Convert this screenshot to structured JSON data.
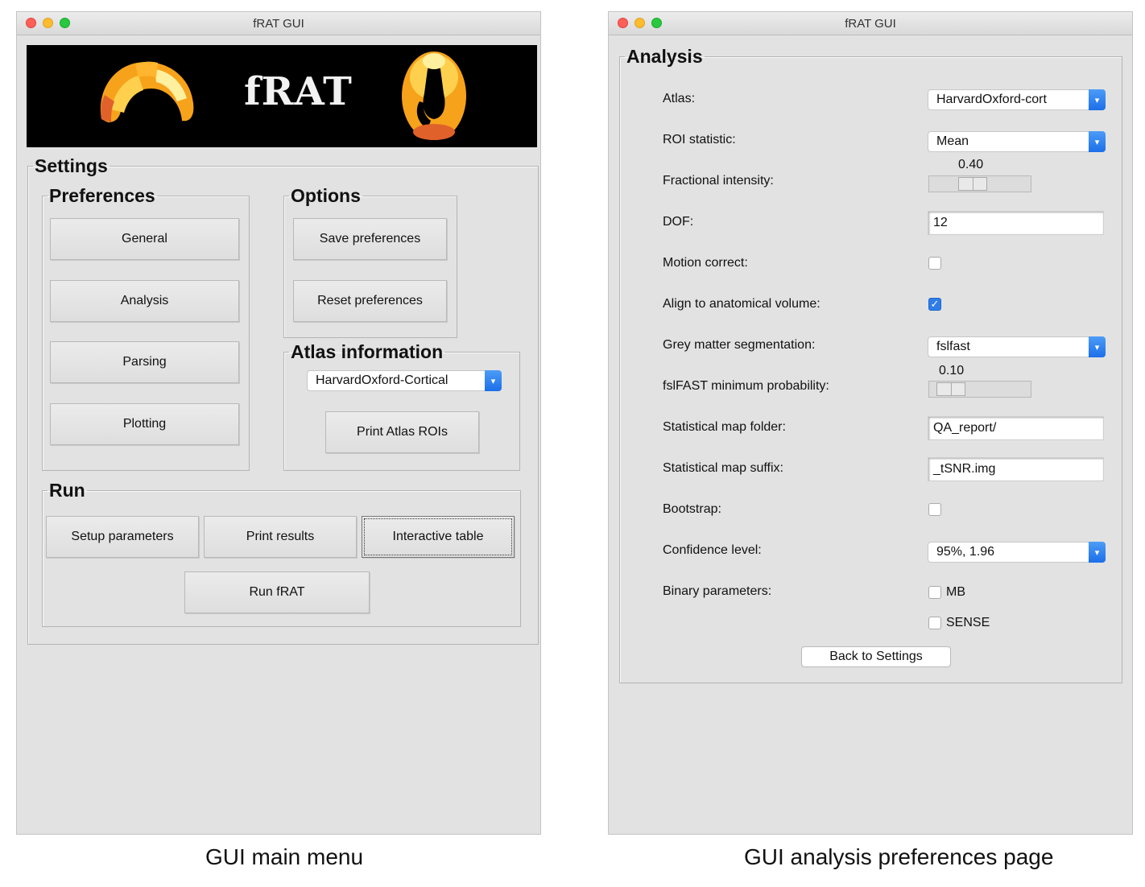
{
  "main_window": {
    "title": "fRAT GUI",
    "banner": {
      "logo_text": "fRAT"
    },
    "settings": {
      "legend": "Settings",
      "preferences": {
        "legend": "Preferences",
        "buttons": [
          "General",
          "Analysis",
          "Parsing",
          "Plotting"
        ]
      },
      "options": {
        "legend": "Options",
        "buttons": [
          "Save preferences",
          "Reset preferences"
        ]
      },
      "atlas_information": {
        "legend": "Atlas information",
        "atlas_select": "HarvardOxford-Cortical",
        "print_button": "Print Atlas ROIs"
      },
      "run": {
        "legend": "Run",
        "setup_button": "Setup parameters",
        "print_results_button": "Print results",
        "interactive_table_button": "Interactive table",
        "run_button": "Run fRAT"
      }
    }
  },
  "analysis_window": {
    "title": "fRAT GUI",
    "legend": "Analysis",
    "fields": {
      "atlas": {
        "label": "Atlas:",
        "value": "HarvardOxford-cort"
      },
      "roi_statistic": {
        "label": "ROI statistic:",
        "value": "Mean"
      },
      "fractional_intensity": {
        "label": "Fractional intensity:",
        "value_text": "0.40",
        "value": 0.4
      },
      "dof": {
        "label": "DOF:",
        "value": "12"
      },
      "motion_correct": {
        "label": "Motion correct:",
        "checked": false
      },
      "align_anatomical": {
        "label": "Align to anatomical volume:",
        "checked": true
      },
      "grey_matter": {
        "label": "Grey matter segmentation:",
        "value": "fslfast"
      },
      "fslfast_min_prob": {
        "label": "fslFAST minimum probability:",
        "value_text": "0.10",
        "value": 0.1
      },
      "stat_map_folder": {
        "label": "Statistical map folder:",
        "value": "QA_report/"
      },
      "stat_map_suffix": {
        "label": "Statistical map suffix:",
        "value": "_tSNR.img"
      },
      "bootstrap": {
        "label": "Bootstrap:",
        "checked": false
      },
      "confidence_level": {
        "label": "Confidence level:",
        "value": "95%, 1.96"
      },
      "binary_parameters": {
        "label": "Binary parameters:",
        "options": [
          {
            "label": "MB",
            "checked": false
          },
          {
            "label": "SENSE",
            "checked": false
          }
        ]
      }
    },
    "back_button": "Back to Settings"
  },
  "captions": {
    "left": "GUI main menu",
    "right": "GUI analysis preferences page"
  },
  "icons": {
    "dropdown": "chevron-down-icon",
    "check": "checkmark-icon"
  },
  "colors": {
    "accent_blue": "#2f7de8",
    "window_bg": "#e2e2e2",
    "banner_bg": "#000000",
    "brain_orange": "#f5a623"
  }
}
